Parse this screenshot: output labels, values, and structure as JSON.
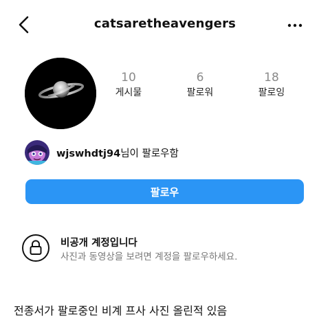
{
  "header": {
    "username": "catsaretheavengers"
  },
  "stats": [
    {
      "value": "10",
      "label": "게시물"
    },
    {
      "value": "6",
      "label": "팔로워"
    },
    {
      "value": "18",
      "label": "팔로잉"
    }
  ],
  "mutual": {
    "name": "wjswhdtj94",
    "suffix": "님이 팔로우함"
  },
  "follow_button": {
    "label": "팔로우",
    "color": "#2b95f5"
  },
  "private_notice": {
    "title": "비공개 계정입니다",
    "subtitle": "사진과 동영상을 보려면 계정을 팔로우하세요."
  },
  "caption": "전종서가 팔로중인 비계 프사 사진 올린적 있음",
  "icons": {
    "back": "chevron-left-icon",
    "more": "ellipsis-icon",
    "lock": "lock-icon"
  }
}
